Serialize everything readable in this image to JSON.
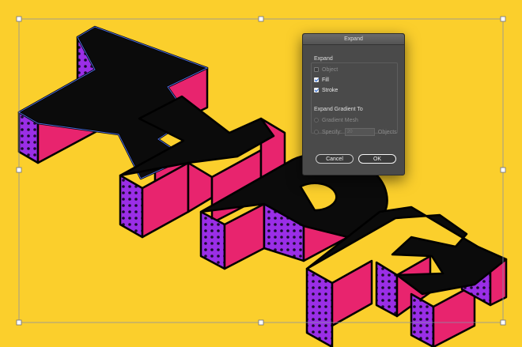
{
  "canvas": {
    "background_color": "#fbcf2c",
    "artwork_text": "TYPE",
    "colors": {
      "face": "#0b0b0b",
      "side": "#e8246e",
      "dotted": "#9a2ee6",
      "outline": "#4b6ad6"
    }
  },
  "dialog": {
    "title": "Expand",
    "expand_label": "Expand",
    "options": [
      {
        "label": "Object",
        "checked": false,
        "enabled": false
      },
      {
        "label": "Fill",
        "checked": true,
        "enabled": true
      },
      {
        "label": "Stroke",
        "checked": true,
        "enabled": true
      }
    ],
    "gradient_label": "Expand Gradient To",
    "gradient_mesh_label": "Gradient Mesh",
    "specify_label": "Specify:",
    "specify_value": "20",
    "objects_label": "Objects",
    "cancel_label": "Cancel",
    "ok_label": "OK"
  }
}
